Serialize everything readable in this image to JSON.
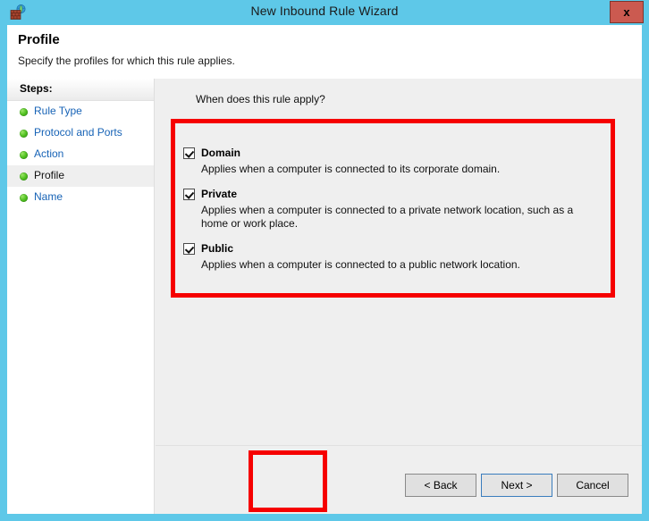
{
  "window": {
    "title": "New Inbound Rule Wizard",
    "icon": "firewall-globe-icon",
    "close_label": "x",
    "titlebar_color": "#5ec8e8",
    "close_button_color": "#cb5a50"
  },
  "header": {
    "title": "Profile",
    "subtitle": "Specify the profiles for which this rule applies."
  },
  "sidebar": {
    "heading": "Steps:",
    "items": [
      {
        "label": "Rule Type",
        "active": false
      },
      {
        "label": "Protocol and Ports",
        "active": false
      },
      {
        "label": "Action",
        "active": false
      },
      {
        "label": "Profile",
        "active": true
      },
      {
        "label": "Name",
        "active": false
      }
    ],
    "link_color": "#1763b6",
    "bullet_color": "#53c222"
  },
  "content": {
    "question": "When does this rule apply?",
    "profiles": [
      {
        "name": "Domain",
        "checked": true,
        "description": "Applies when a computer is connected to its corporate domain."
      },
      {
        "name": "Private",
        "checked": true,
        "description": "Applies when a computer is connected to a private network location, such as a home or work place."
      },
      {
        "name": "Public",
        "checked": true,
        "description": "Applies when a computer is connected to a public network location."
      }
    ]
  },
  "buttons": {
    "back": "< Back",
    "next": "Next >",
    "cancel": "Cancel",
    "focused": "next"
  },
  "annotations": {
    "color": "#f60000",
    "regions": [
      "profiles-group",
      "next-button"
    ]
  }
}
